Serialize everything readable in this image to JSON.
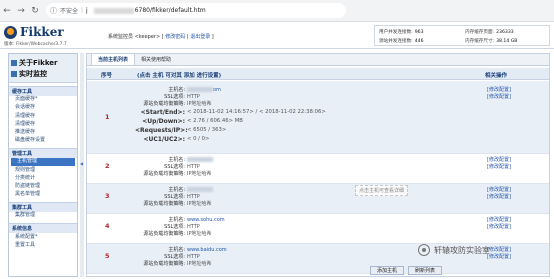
{
  "browser": {
    "security_label": "不安全",
    "url_separator": "|",
    "url_visible": "6780/fikker/default.htm",
    "url_prefix": "j"
  },
  "header": {
    "logo_text": "Fikker",
    "version": "版本: Fikker/Webcache/3.7.7",
    "monitor_prefix": "系统监控员 <keeper>",
    "change_password": "修改密码",
    "logout": "退出登录",
    "stats": [
      {
        "label": "用户并发连接数:",
        "value": "963"
      },
      {
        "label": "内存缓存页面:",
        "value": "236333"
      },
      {
        "label": "源站并发连接数:",
        "value": "446"
      },
      {
        "label": "内存缓存尺寸:",
        "value": "38.14 GB"
      }
    ]
  },
  "sidebar": {
    "about": "关于Fikker",
    "realtime": "实时监控",
    "sections": [
      {
        "title": "缓存工具",
        "items": [
          "页面缓存*",
          "会话缓存",
          "清理缓存",
          "清理缓存",
          "推送缓存",
          "磁盘缓存设置"
        ]
      },
      {
        "title": "管理工具",
        "items": [
          "主机管理",
          "规则管理",
          "分类统计",
          "防盗链管理",
          "黑名单管理"
        ]
      },
      {
        "title": "集群工具",
        "items": [
          "集群管理"
        ]
      },
      {
        "title": "系统信息",
        "items": [
          "系统配置*",
          "重置工具"
        ]
      }
    ]
  },
  "main": {
    "tabs": [
      "当前主机列表",
      "相关使用帮助"
    ],
    "columns": {
      "num": "序号",
      "desc": "(点击 主机 可对其 添加 进行设置)",
      "ops": "相关操作"
    },
    "row_labels": [
      "主机名:",
      "SSL选项:",
      "源站负载均衡策略:"
    ],
    "extra_labels": [
      "<Start/End>:",
      "<Up/Down>:",
      "<Requests/IP>:",
      "<UC1/UC2>:"
    ],
    "ops": [
      "[修改配置]",
      "[修改配置]"
    ],
    "rows": [
      {
        "num": "1",
        "host_suffix": "om",
        "ssl": "HTTP",
        "balance": "IP地址哈希",
        "start_end": "< 2018-11-02 14:16:57> / < 2018-11-02 22:38:06>",
        "up_down": "< 2.76 / 606.46> MB",
        "requests": "< 6505 / 363>",
        "uc": "< 0 / 0>"
      },
      {
        "num": "2",
        "host_suffix": "",
        "ssl": "HTTP",
        "balance": "IP地址哈希"
      },
      {
        "num": "3",
        "host_suffix": "",
        "ssl": "HTTP",
        "balance": "IP地址哈希"
      },
      {
        "num": "4",
        "host_suffix": "www.sohu.com",
        "ssl": "HTTP",
        "balance": "IP地址哈希"
      },
      {
        "num": "5",
        "host_suffix": "www.baidu.com",
        "ssl": "HTTP",
        "balance": "IP地址哈希"
      }
    ],
    "tooltip": "点击主机可查看详细",
    "buttons": [
      "添加主机",
      "刷新列表"
    ]
  },
  "watermark": "轩辕攻防实验室"
}
